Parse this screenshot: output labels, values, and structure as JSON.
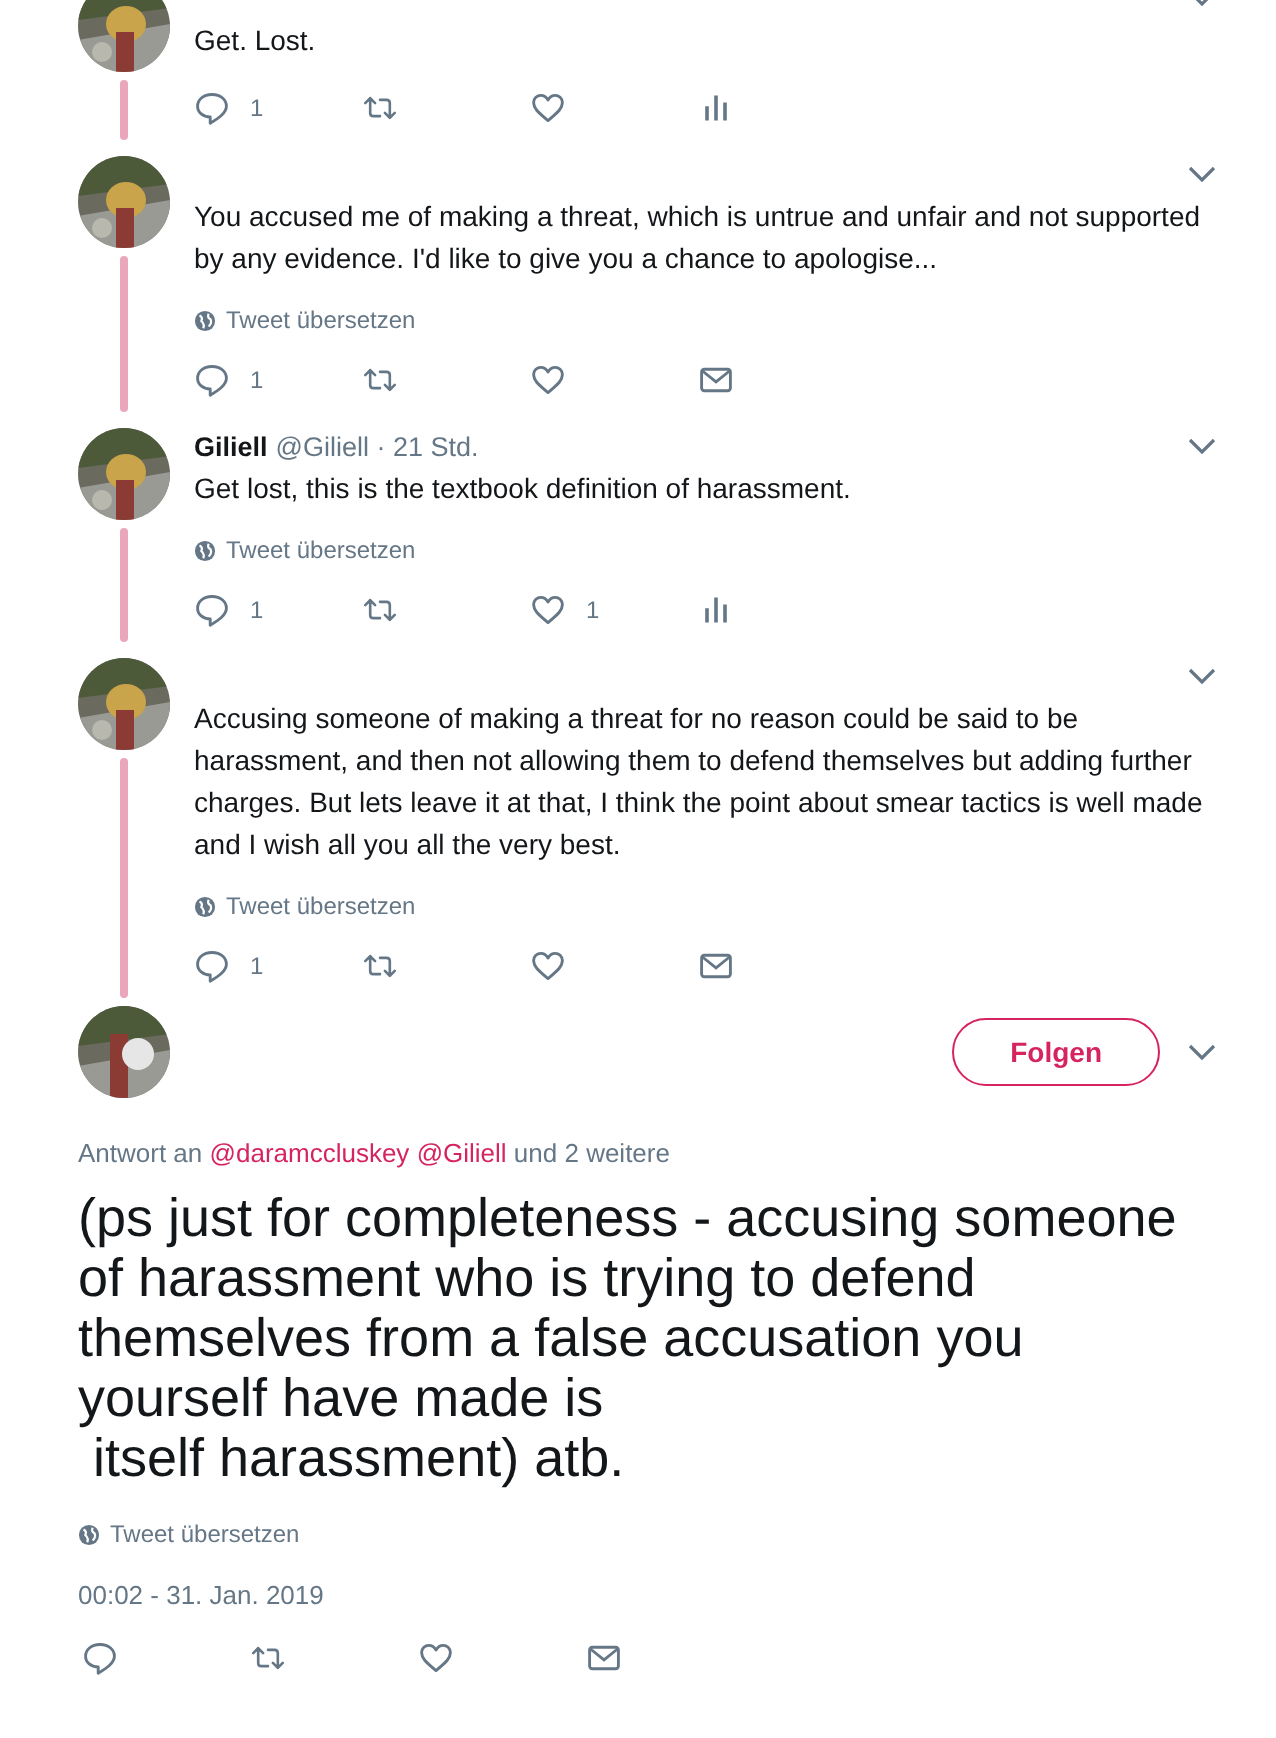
{
  "thread": [
    {
      "text": "Get. Lost.",
      "actions": [
        {
          "kind": "reply",
          "count": "1"
        },
        {
          "kind": "retweet"
        },
        {
          "kind": "like"
        },
        {
          "kind": "stats"
        }
      ]
    },
    {
      "text": "You accused me of making a threat, which is untrue and unfair and not supported by any evidence. I'd like to give you a chance to apologise...",
      "translate": "Tweet übersetzen",
      "actions": [
        {
          "kind": "reply",
          "count": "1"
        },
        {
          "kind": "retweet"
        },
        {
          "kind": "like"
        },
        {
          "kind": "mail"
        }
      ]
    },
    {
      "name": "Giliell",
      "handle_time": "@Giliell · 21 Std.",
      "text": "Get lost, this is the textbook definition of harassment.",
      "translate": "Tweet übersetzen",
      "actions": [
        {
          "kind": "reply",
          "count": "1"
        },
        {
          "kind": "retweet"
        },
        {
          "kind": "like",
          "count": "1"
        },
        {
          "kind": "stats"
        }
      ]
    },
    {
      "text": "Accusing someone of making a threat for no reason could be said to be harassment, and then not allowing them to defend themselves but adding further charges. But lets leave it at that, I think the point about smear tactics is well made and I wish all you all the very best.",
      "translate": "Tweet übersetzen",
      "actions": [
        {
          "kind": "reply",
          "count": "1"
        },
        {
          "kind": "retweet"
        },
        {
          "kind": "like"
        },
        {
          "kind": "mail"
        }
      ]
    }
  ],
  "main_tweet": {
    "follow_button": "Folgen",
    "reply_to": [
      {
        "kind": "text",
        "text": "Antwort an"
      },
      {
        "kind": "mention",
        "text": "@daramccluskey"
      },
      {
        "kind": "mention",
        "text": "@Giliell"
      },
      {
        "kind": "text",
        "text": "und 2 weitere"
      }
    ],
    "text": "(ps just for completeness - accusing someone\nof harassment who is trying to defend\nthemselves from a false accusation you\nyourself have made is\n itself harassment) atb.",
    "translate": "Tweet übersetzen",
    "timestamp": "00:02 - 31. Jan. 2019",
    "actions": [
      {
        "kind": "reply"
      },
      {
        "kind": "retweet"
      },
      {
        "kind": "like"
      },
      {
        "kind": "mail"
      }
    ]
  }
}
